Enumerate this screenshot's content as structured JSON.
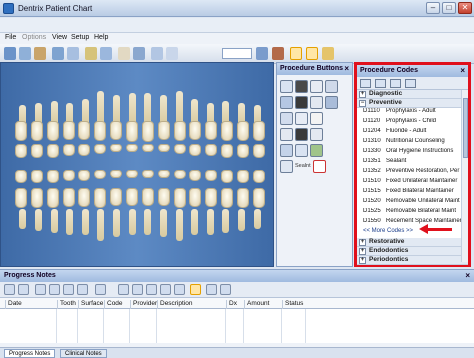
{
  "window": {
    "title": "Dentrix Patient Chart",
    "controls": [
      "–",
      "□",
      "✕"
    ]
  },
  "menu": [
    "File",
    "Options",
    "View",
    "Setup",
    "Help"
  ],
  "toolbar": {
    "icons": [
      "chart-icon",
      "patient-icon",
      "family-icon",
      "ledger-icon",
      "prescription-icon",
      "appointment-icon",
      "perio-icon",
      "tooth-icon",
      "xray-icon",
      "camera-icon",
      "document-icon",
      "note-icon"
    ],
    "selected_icon": "chart-icon"
  },
  "chart": {
    "tooth_numbers_upper": [
      "1",
      "2",
      "3",
      "4",
      "5",
      "6",
      "7",
      "8",
      "9",
      "10",
      "11",
      "12",
      "13",
      "14",
      "15",
      "16"
    ],
    "tooth_numbers_lower": [
      "32",
      "31",
      "30",
      "29",
      "28",
      "27",
      "26",
      "25",
      "24",
      "23",
      "22",
      "21",
      "20",
      "19",
      "18",
      "17"
    ]
  },
  "procedure_buttons": {
    "title": "Procedure Buttons",
    "close": "×",
    "sealant_label": "Sealnt"
  },
  "procedure_codes": {
    "title": "Procedure Codes",
    "close": "×",
    "categories": [
      {
        "label": "Diagnostic",
        "state": "+"
      },
      {
        "label": "Preventive",
        "state": "−"
      }
    ],
    "codes": [
      {
        "code": "D1110",
        "desc": "Prophylaxis - Adult"
      },
      {
        "code": "D1120",
        "desc": "Prophylaxis - Child"
      },
      {
        "code": "D1204",
        "desc": "Fluoride - Adult"
      },
      {
        "code": "D1310",
        "desc": "Nutritional Counseling"
      },
      {
        "code": "D1330",
        "desc": "Oral Hygiene Instructions"
      },
      {
        "code": "D1351",
        "desc": "Sealant"
      },
      {
        "code": "D1352",
        "desc": "Preventive Restoration, Per"
      },
      {
        "code": "D1510",
        "desc": "Fixed Unilateral Maintainer"
      },
      {
        "code": "D1515",
        "desc": "Fixed Bilateral Maintainer"
      },
      {
        "code": "D1520",
        "desc": "Removable Unilateral Maint"
      },
      {
        "code": "D1525",
        "desc": "Removable Bilateral Maint"
      },
      {
        "code": "D1550",
        "desc": "Recement Space Maintainer"
      }
    ],
    "more_codes": "<< More Codes >>",
    "categories_after": [
      {
        "label": "Restorative",
        "state": "+"
      },
      {
        "label": "Endodontics",
        "state": "+"
      },
      {
        "label": "Periodontics",
        "state": "+"
      }
    ],
    "highlight_color": "#e0101c"
  },
  "progress_notes": {
    "title": "Progress Notes",
    "close": "×",
    "columns": [
      "Date",
      "Tooth",
      "Surface",
      "Code",
      "Provider",
      "Description",
      "Dx",
      "Amount",
      "Status"
    ],
    "tabs": [
      "Progress Notes",
      "Clinical Notes"
    ],
    "active_tab": "Progress Notes"
  }
}
